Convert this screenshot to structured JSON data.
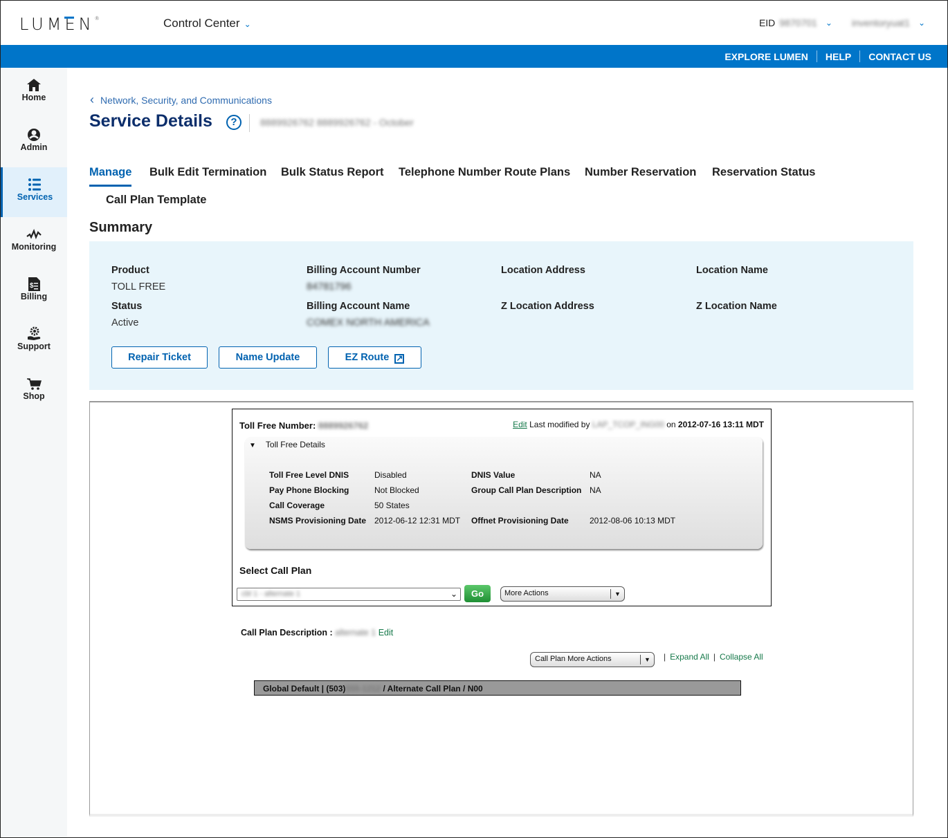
{
  "header": {
    "logo_text": "LUMEN",
    "logo_mark": "®",
    "app_switcher": "Control Center",
    "eid_label": "EID",
    "eid_value": "9870701",
    "user_value": "inventoryuat1"
  },
  "utility_nav": [
    "EXPLORE LUMEN",
    "HELP",
    "CONTACT US"
  ],
  "sidebar": {
    "items": [
      {
        "label": "Home",
        "icon": "home-icon",
        "glyph": "⌂"
      },
      {
        "label": "Admin",
        "icon": "user-circle-icon",
        "glyph": "☻"
      },
      {
        "label": "Services",
        "icon": "list-icon",
        "glyph": "☰",
        "active": true
      },
      {
        "label": "Monitoring",
        "icon": "pulse-icon",
        "glyph": "⩘"
      },
      {
        "label": "Billing",
        "icon": "invoice-icon",
        "glyph": "▤"
      },
      {
        "label": "Support",
        "icon": "support-hand-gear-icon",
        "glyph": "⚙"
      },
      {
        "label": "Shop",
        "icon": "cart-icon",
        "glyph": "🛒"
      }
    ]
  },
  "breadcrumb": {
    "back_glyph": "‹",
    "label": "Network, Security, and Communications"
  },
  "page": {
    "title": "Service Details",
    "help_glyph": "?",
    "subtitle_blurred": "8889926762   8889926762 - October"
  },
  "tabs": [
    {
      "label": "Manage",
      "active": true
    },
    {
      "label": "Bulk Edit Termination"
    },
    {
      "label": "Bulk Status Report"
    },
    {
      "label": "Telephone Number Route Plans"
    },
    {
      "label": "Number Reservation"
    },
    {
      "label": "Reservation Status"
    },
    {
      "label": "Call Plan Template"
    }
  ],
  "summary": {
    "heading": "Summary",
    "fields": {
      "product_label": "Product",
      "product_value": "TOLL FREE",
      "status_label": "Status",
      "status_value": "Active",
      "ban_label": "Billing Account Number",
      "ban_value": "84781796",
      "ban_name_label": "Billing Account Name",
      "ban_name_value": "COMEX NORTH AMERICA",
      "loc_addr_label": "Location Address",
      "z_loc_addr_label": "Z Location Address",
      "loc_name_label": "Location Name",
      "z_loc_name_label": "Z Location Name"
    },
    "buttons": {
      "repair": "Repair Ticket",
      "name_update": "Name Update",
      "ez_route": "EZ Route",
      "external_glyph": "↗"
    }
  },
  "tollfree": {
    "number_label": "Toll Free Number:",
    "number_value": "8889926762",
    "edit": "Edit",
    "last_modified_prefix": "Last modified by",
    "last_modified_user": "LAP_TCOP_ING00",
    "last_modified_on": "on",
    "last_modified_date": "2012-07-16 13:11 MDT",
    "details_toggle": "Toll Free Details",
    "details": {
      "tf_level_dnis_label": "Toll Free Level DNIS",
      "tf_level_dnis_value": "Disabled",
      "payphone_label": "Pay Phone Blocking",
      "payphone_value": "Not Blocked",
      "coverage_label": "Call Coverage",
      "coverage_value": "50 States",
      "nsms_label": "NSMS Provisioning Date",
      "nsms_value": "2012-06-12 12:31 MDT",
      "dnis_value_label": "DNIS Value",
      "dnis_value_value": "NA",
      "group_cp_label": "Group Call Plan Description",
      "group_cp_value": "NA",
      "offnet_label": "Offnet Provisioning Date",
      "offnet_value": "2012-08-06 10:13 MDT"
    },
    "select_call_plan_label": "Select Call Plan",
    "select_call_plan_value": "cbl 1 - alternate 1",
    "go": "Go",
    "more_actions": "More Actions"
  },
  "call_plan": {
    "desc_label": "Call Plan Description :",
    "desc_value": "alternate 1",
    "edit": "Edit",
    "more_actions": "Call Plan More Actions",
    "expand_all": "Expand All",
    "collapse_all": "Collapse All",
    "row_prefix": "Global Default | (503)",
    "row_blurred": "555-1212",
    "row_suffix": "/ Alternate Call Plan / N00"
  },
  "colors": {
    "brand_blue": "#0075c9",
    "nav_active": "#0062b0",
    "title_navy": "#0c2e6b",
    "link_green": "#16794a",
    "summary_bg": "#e8f5fb"
  }
}
